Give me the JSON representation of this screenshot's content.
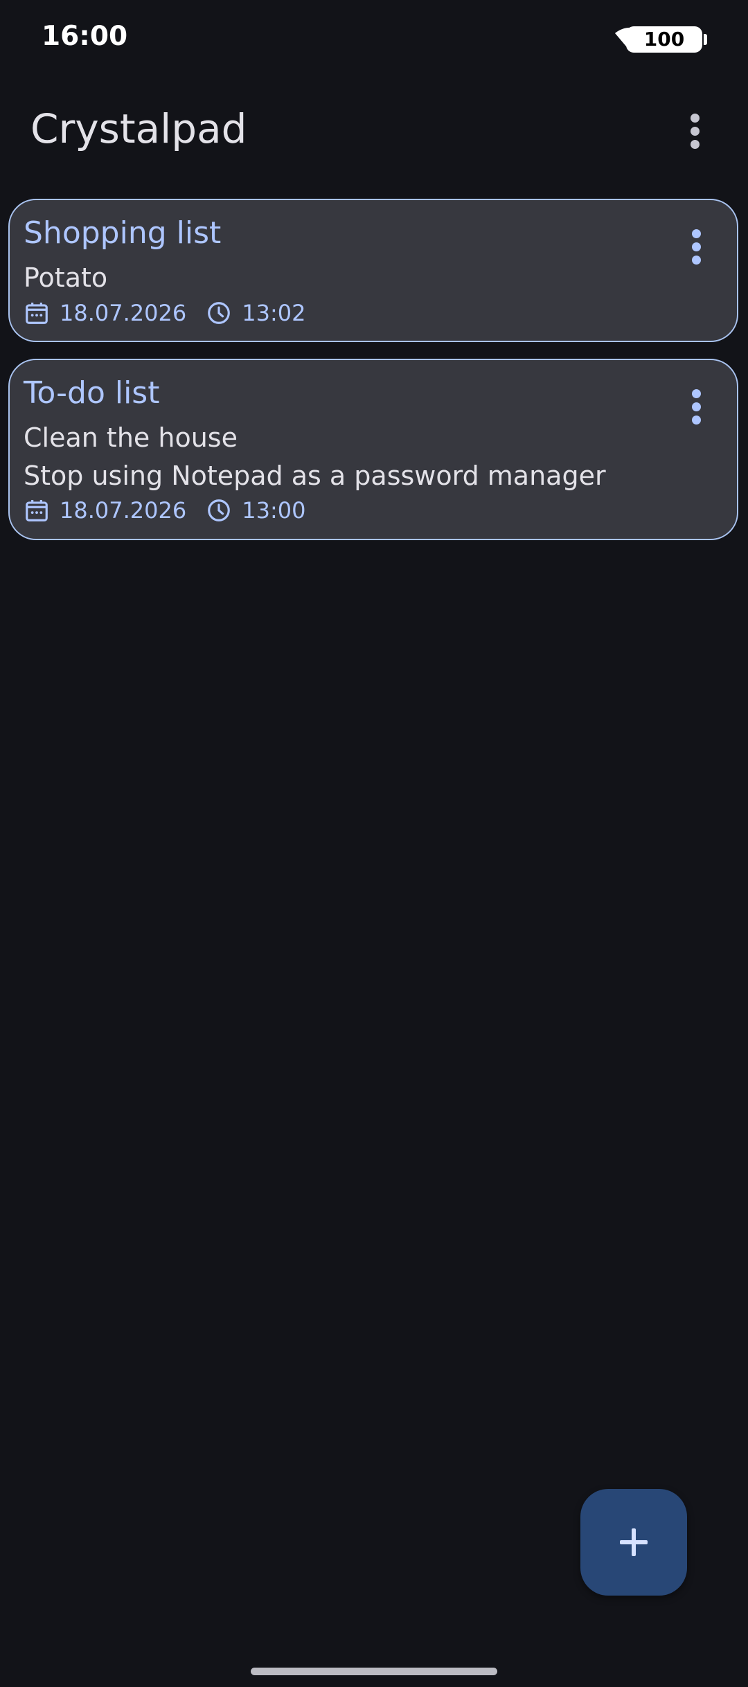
{
  "status_bar": {
    "time": "16:00",
    "battery": "100",
    "wifi_icon": "wifi-icon"
  },
  "app_bar": {
    "title": "Crystalpad",
    "menu_icon": "more-vert-icon"
  },
  "notes": [
    {
      "title": "Shopping list",
      "lines": [
        "Potato"
      ],
      "date": "18.07.2026",
      "time": "13:02"
    },
    {
      "title": "To-do list",
      "lines": [
        "Clean the house",
        "Stop using Notepad as a password manager"
      ],
      "date": "18.07.2026",
      "time": "13:00"
    }
  ],
  "fab": {
    "icon": "plus-icon"
  },
  "colors": {
    "background": "#121318",
    "card": "#37383f",
    "accent": "#aec6ff",
    "fab": "#284776"
  }
}
